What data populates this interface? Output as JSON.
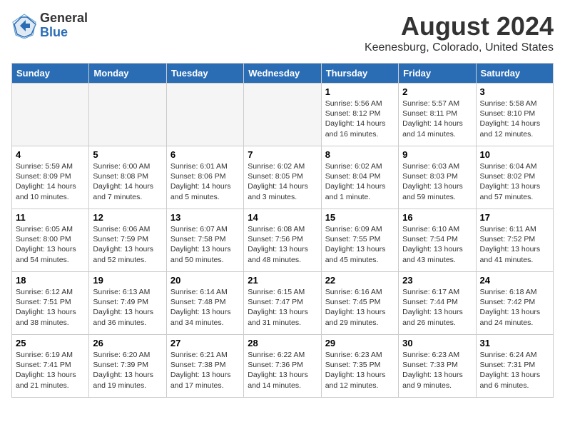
{
  "logo": {
    "general": "General",
    "blue": "Blue"
  },
  "title": "August 2024",
  "location": "Keenesburg, Colorado, United States",
  "headers": [
    "Sunday",
    "Monday",
    "Tuesday",
    "Wednesday",
    "Thursday",
    "Friday",
    "Saturday"
  ],
  "weeks": [
    [
      {
        "day": "",
        "info": ""
      },
      {
        "day": "",
        "info": ""
      },
      {
        "day": "",
        "info": ""
      },
      {
        "day": "",
        "info": ""
      },
      {
        "day": "1",
        "info": "Sunrise: 5:56 AM\nSunset: 8:12 PM\nDaylight: 14 hours\nand 16 minutes."
      },
      {
        "day": "2",
        "info": "Sunrise: 5:57 AM\nSunset: 8:11 PM\nDaylight: 14 hours\nand 14 minutes."
      },
      {
        "day": "3",
        "info": "Sunrise: 5:58 AM\nSunset: 8:10 PM\nDaylight: 14 hours\nand 12 minutes."
      }
    ],
    [
      {
        "day": "4",
        "info": "Sunrise: 5:59 AM\nSunset: 8:09 PM\nDaylight: 14 hours\nand 10 minutes."
      },
      {
        "day": "5",
        "info": "Sunrise: 6:00 AM\nSunset: 8:08 PM\nDaylight: 14 hours\nand 7 minutes."
      },
      {
        "day": "6",
        "info": "Sunrise: 6:01 AM\nSunset: 8:06 PM\nDaylight: 14 hours\nand 5 minutes."
      },
      {
        "day": "7",
        "info": "Sunrise: 6:02 AM\nSunset: 8:05 PM\nDaylight: 14 hours\nand 3 minutes."
      },
      {
        "day": "8",
        "info": "Sunrise: 6:02 AM\nSunset: 8:04 PM\nDaylight: 14 hours\nand 1 minute."
      },
      {
        "day": "9",
        "info": "Sunrise: 6:03 AM\nSunset: 8:03 PM\nDaylight: 13 hours\nand 59 minutes."
      },
      {
        "day": "10",
        "info": "Sunrise: 6:04 AM\nSunset: 8:02 PM\nDaylight: 13 hours\nand 57 minutes."
      }
    ],
    [
      {
        "day": "11",
        "info": "Sunrise: 6:05 AM\nSunset: 8:00 PM\nDaylight: 13 hours\nand 54 minutes."
      },
      {
        "day": "12",
        "info": "Sunrise: 6:06 AM\nSunset: 7:59 PM\nDaylight: 13 hours\nand 52 minutes."
      },
      {
        "day": "13",
        "info": "Sunrise: 6:07 AM\nSunset: 7:58 PM\nDaylight: 13 hours\nand 50 minutes."
      },
      {
        "day": "14",
        "info": "Sunrise: 6:08 AM\nSunset: 7:56 PM\nDaylight: 13 hours\nand 48 minutes."
      },
      {
        "day": "15",
        "info": "Sunrise: 6:09 AM\nSunset: 7:55 PM\nDaylight: 13 hours\nand 45 minutes."
      },
      {
        "day": "16",
        "info": "Sunrise: 6:10 AM\nSunset: 7:54 PM\nDaylight: 13 hours\nand 43 minutes."
      },
      {
        "day": "17",
        "info": "Sunrise: 6:11 AM\nSunset: 7:52 PM\nDaylight: 13 hours\nand 41 minutes."
      }
    ],
    [
      {
        "day": "18",
        "info": "Sunrise: 6:12 AM\nSunset: 7:51 PM\nDaylight: 13 hours\nand 38 minutes."
      },
      {
        "day": "19",
        "info": "Sunrise: 6:13 AM\nSunset: 7:49 PM\nDaylight: 13 hours\nand 36 minutes."
      },
      {
        "day": "20",
        "info": "Sunrise: 6:14 AM\nSunset: 7:48 PM\nDaylight: 13 hours\nand 34 minutes."
      },
      {
        "day": "21",
        "info": "Sunrise: 6:15 AM\nSunset: 7:47 PM\nDaylight: 13 hours\nand 31 minutes."
      },
      {
        "day": "22",
        "info": "Sunrise: 6:16 AM\nSunset: 7:45 PM\nDaylight: 13 hours\nand 29 minutes."
      },
      {
        "day": "23",
        "info": "Sunrise: 6:17 AM\nSunset: 7:44 PM\nDaylight: 13 hours\nand 26 minutes."
      },
      {
        "day": "24",
        "info": "Sunrise: 6:18 AM\nSunset: 7:42 PM\nDaylight: 13 hours\nand 24 minutes."
      }
    ],
    [
      {
        "day": "25",
        "info": "Sunrise: 6:19 AM\nSunset: 7:41 PM\nDaylight: 13 hours\nand 21 minutes."
      },
      {
        "day": "26",
        "info": "Sunrise: 6:20 AM\nSunset: 7:39 PM\nDaylight: 13 hours\nand 19 minutes."
      },
      {
        "day": "27",
        "info": "Sunrise: 6:21 AM\nSunset: 7:38 PM\nDaylight: 13 hours\nand 17 minutes."
      },
      {
        "day": "28",
        "info": "Sunrise: 6:22 AM\nSunset: 7:36 PM\nDaylight: 13 hours\nand 14 minutes."
      },
      {
        "day": "29",
        "info": "Sunrise: 6:23 AM\nSunset: 7:35 PM\nDaylight: 13 hours\nand 12 minutes."
      },
      {
        "day": "30",
        "info": "Sunrise: 6:23 AM\nSunset: 7:33 PM\nDaylight: 13 hours\nand 9 minutes."
      },
      {
        "day": "31",
        "info": "Sunrise: 6:24 AM\nSunset: 7:31 PM\nDaylight: 13 hours\nand 6 minutes."
      }
    ]
  ]
}
